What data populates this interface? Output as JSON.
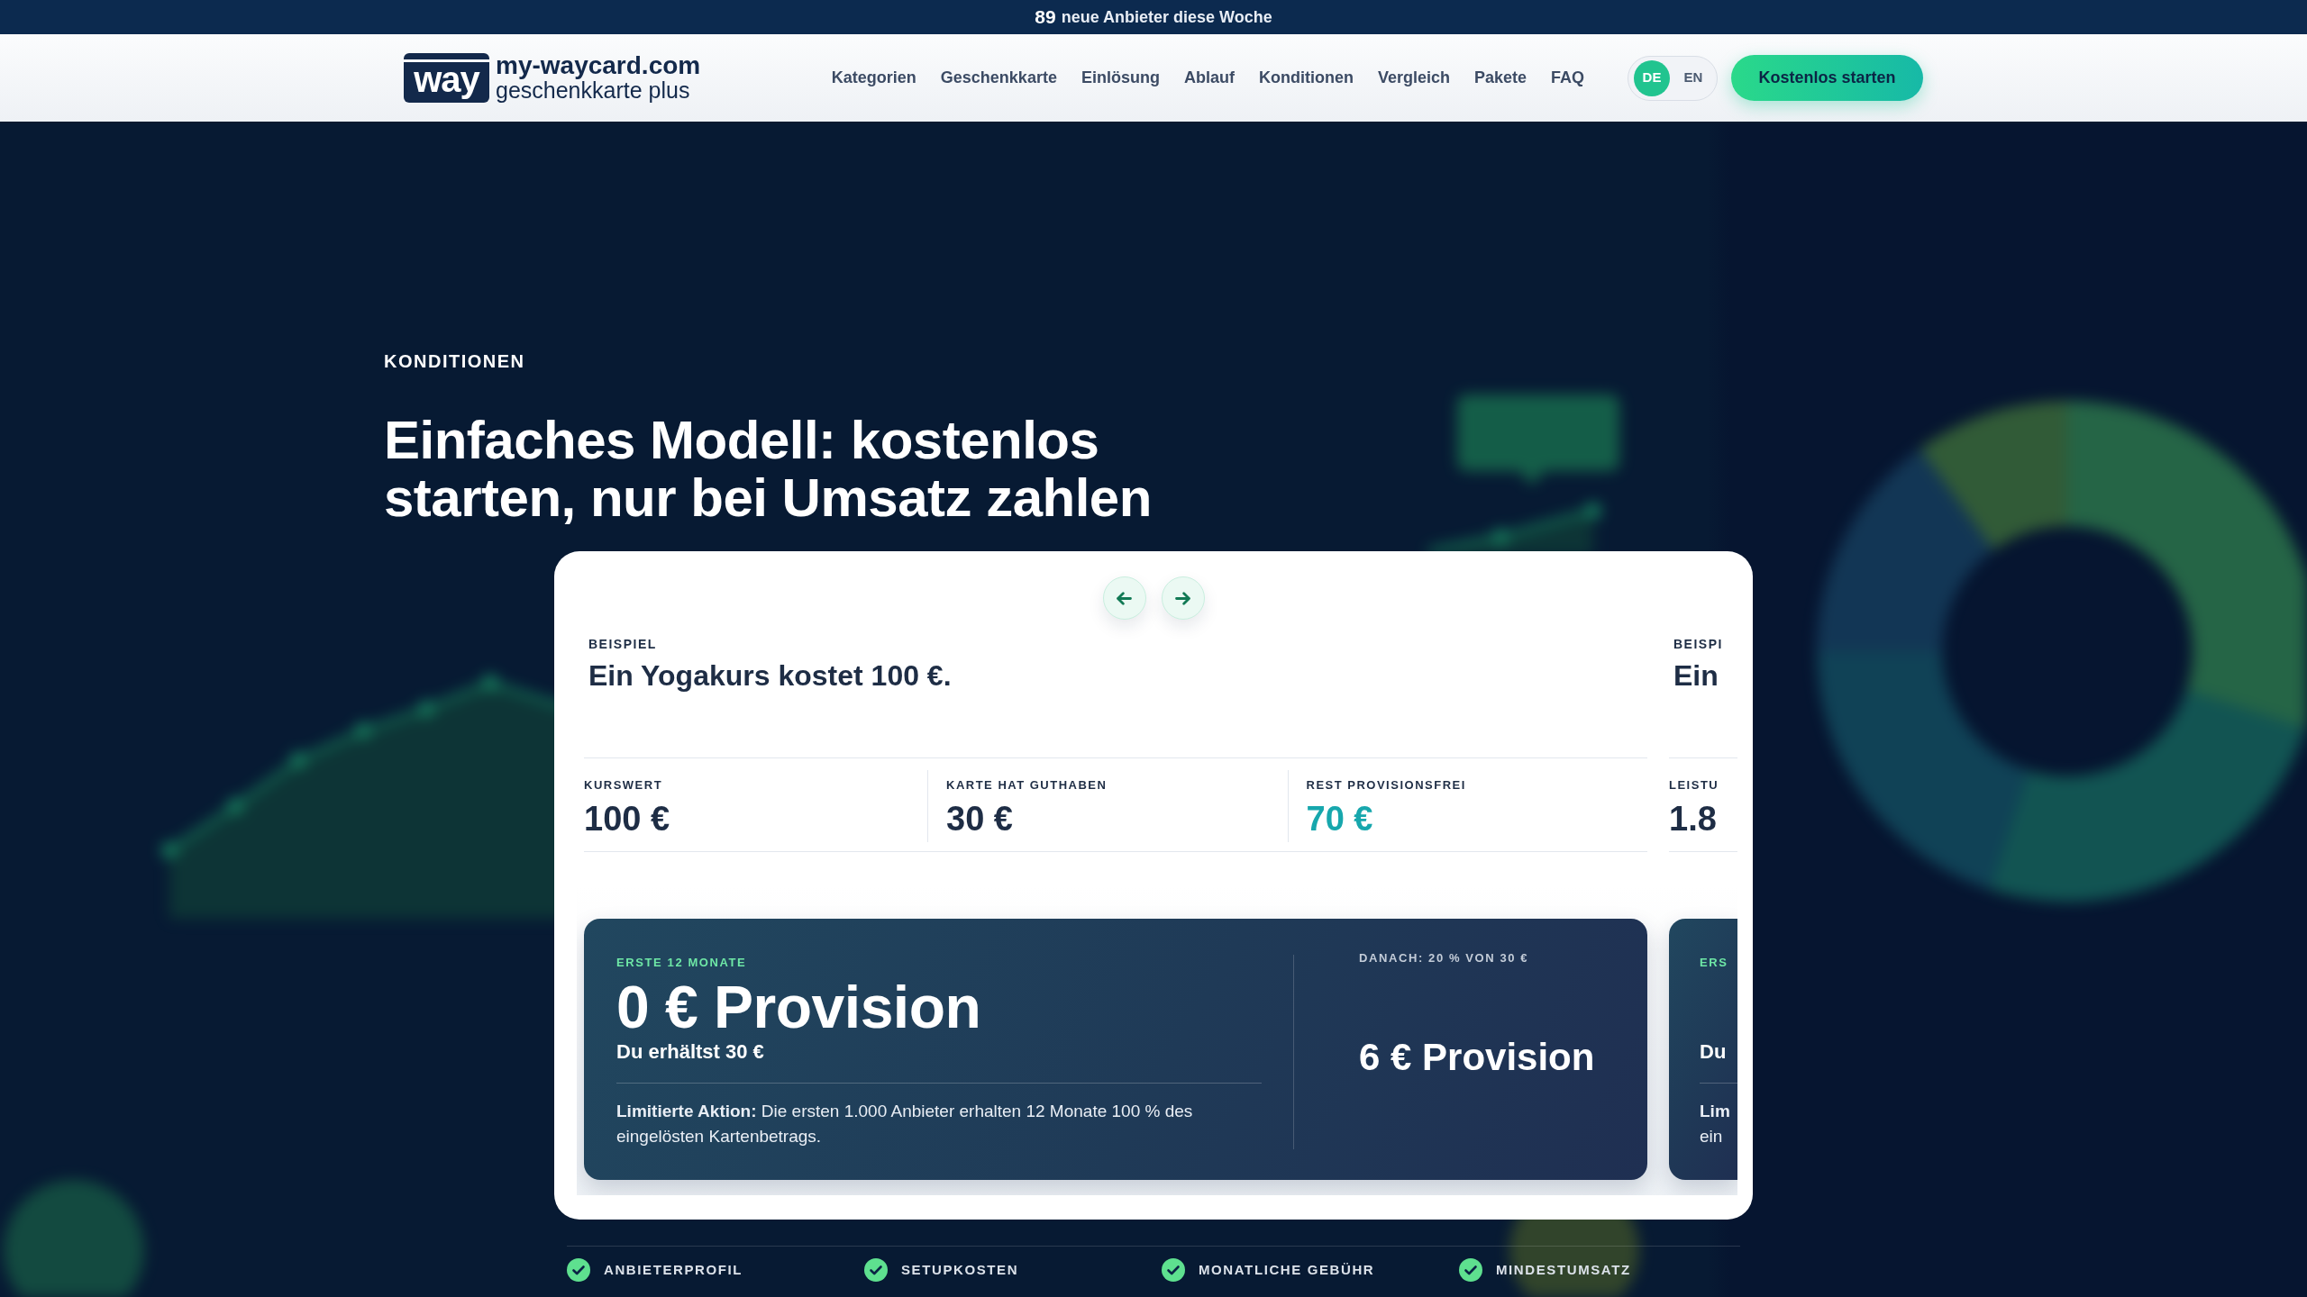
{
  "announcement": {
    "count": "89",
    "text": "neue Anbieter diese Woche"
  },
  "navbar": {
    "logo": {
      "mark": "way",
      "name": "my-waycard.com",
      "tagline": "geschenkkarte plus"
    },
    "links": [
      "Kategorien",
      "Geschenkkarte",
      "Einlösung",
      "Ablauf",
      "Konditionen",
      "Vergleich",
      "Pakete",
      "FAQ"
    ],
    "languages": [
      {
        "label": "DE",
        "selected": true
      },
      {
        "label": "EN",
        "selected": false
      }
    ],
    "cta": "Kostenlos starten"
  },
  "hero": {
    "eyebrow": "KONDITIONEN",
    "title": "Einfaches Modell: kostenlos starten, nur bei Umsatz zahlen"
  },
  "carousel": {
    "buttons": [
      {
        "kind": "prev"
      },
      {
        "kind": "next"
      }
    ],
    "slides": [
      {
        "label": "BEISPIEL",
        "title": "Ein Yogakurs kostet 100 €.",
        "stats": [
          {
            "label": "KURSWERT",
            "value": "100 €",
            "kind": "plain"
          },
          {
            "label": "KARTE HAT GUTHABEN",
            "value": "30 €",
            "kind": "plain"
          },
          {
            "label": "REST PROVISIONSFREI",
            "value": "70 €",
            "kind": "accent"
          }
        ],
        "offer": {
          "eyebrow": "ERSTE 12 MONATE",
          "title": "0 € Provision",
          "subtitle": "Du erhältst 30 €",
          "note": "**Limitierte Aktion:** Die ersten 1.000 Anbieter erhalten 12 Monate 100 % des eingelösten Kartenbetrags.",
          "after_label": "DANACH: 20 % VON 30 €",
          "after_value": "6 € Provision"
        }
      },
      {
        "label": "BEISPI",
        "title": "Ein",
        "stats": [
          {
            "label": "LEISTU",
            "value": "1.8",
            "kind": "plain"
          }
        ],
        "offer": {
          "eyebrow": "ERS",
          "subtitle": "Du",
          "note": "**Lim** ein"
        }
      }
    ]
  },
  "features": [
    "ANBIETERPROFIL",
    "SETUPKOSTEN",
    "MONATLICHE GEBÜHR",
    "MINDESTUMSATZ"
  ]
}
